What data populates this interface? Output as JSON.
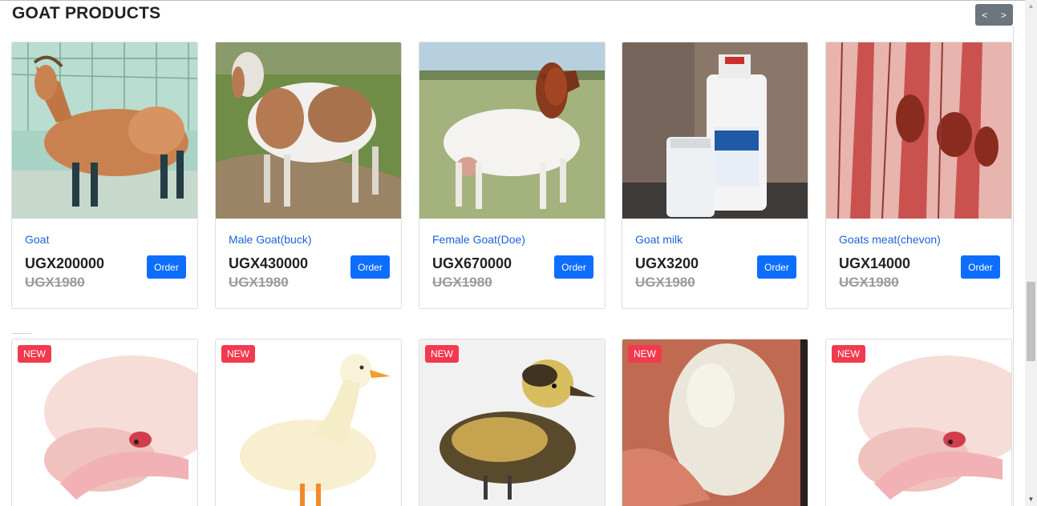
{
  "section": {
    "title": "GOAT PRODUCTS",
    "prev_label": "<",
    "next_label": ">"
  },
  "products": [
    {
      "name": "Goat",
      "price": "UGX200000",
      "old_price": "UGX1980",
      "order_label": "Order"
    },
    {
      "name": "Male Goat(buck)",
      "price": "UGX430000",
      "old_price": "UGX1980",
      "order_label": "Order"
    },
    {
      "name": "Female Goat(Doe)",
      "price": "UGX670000",
      "old_price": "UGX1980",
      "order_label": "Order"
    },
    {
      "name": "Goat milk",
      "price": "UGX3200",
      "old_price": "UGX1980",
      "order_label": "Order"
    },
    {
      "name": "Goats meat(chevon)",
      "price": "UGX14000",
      "old_price": "UGX1980",
      "order_label": "Order"
    }
  ],
  "new_items": [
    {
      "badge": "NEW"
    },
    {
      "badge": "NEW"
    },
    {
      "badge": "NEW"
    },
    {
      "badge": "NEW"
    },
    {
      "badge": "NEW"
    }
  ],
  "colors": {
    "accent": "#0d6efd",
    "link": "#1a63d8",
    "badge": "#f23a4e",
    "nav": "#6c757d"
  },
  "icons": {
    "scroll_up": "scroll-up-arrow-icon",
    "scroll_down": "scroll-down-arrow-icon"
  }
}
